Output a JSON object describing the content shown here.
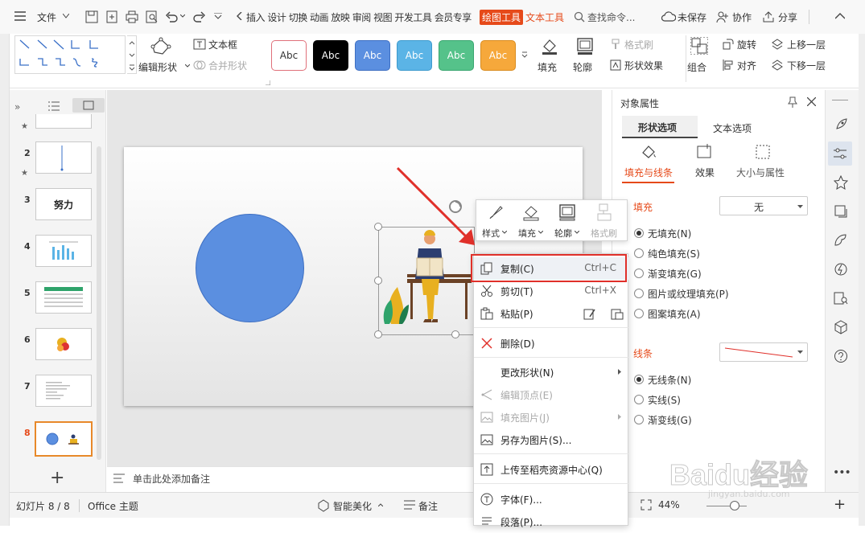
{
  "titlebar": {
    "menu_label": "文件",
    "tabs": [
      "插入",
      "设计",
      "切换",
      "动画",
      "放映",
      "审阅",
      "视图",
      "开发工具",
      "会员专享"
    ],
    "active_tab": "绘图工具",
    "extra_tab": "文本工具",
    "search_placeholder": "查找命令...",
    "unsaved": "未保存",
    "collab": "协作",
    "share": "分享"
  },
  "ribbon": {
    "edit_shape": "编辑形状",
    "textbox": "文本框",
    "merge_shape": "合并形状",
    "style_samples": [
      "Abc",
      "Abc",
      "Abc",
      "Abc",
      "Abc",
      "Abc"
    ],
    "fill": "填充",
    "outline": "轮廓",
    "format_painter": "格式刷",
    "shape_effects": "形状效果",
    "group": "组合",
    "rotate": "旋转",
    "align": "对齐",
    "bring_forward": "上移一层",
    "send_backward": "下移一层"
  },
  "slides": {
    "numbers": [
      "2",
      "3",
      "4",
      "5",
      "6",
      "7",
      "8"
    ],
    "thumb3_text": "努力",
    "active": "8"
  },
  "notes_placeholder": "单击此处添加备注",
  "status": {
    "slide_count": "幻灯片 8 / 8",
    "theme": "Office 主题",
    "beautify": "智能美化",
    "notes": "备注",
    "zoom": "44%"
  },
  "right_panel": {
    "title": "对象属性",
    "tab_shape": "形状选项",
    "tab_text": "文本选项",
    "sub_fill_line": "填充与线条",
    "sub_effects": "效果",
    "sub_size": "大小与属性",
    "fill_heading": "填充",
    "fill_value": "无",
    "fill_options": [
      "无填充(N)",
      "纯色填充(S)",
      "渐变填充(G)",
      "图片或纹理填充(P)",
      "图案填充(A)"
    ],
    "line_heading": "线条",
    "line_options": [
      "无线条(N)",
      "实线(S)",
      "渐变线(G)"
    ]
  },
  "mini_toolbar": {
    "style": "样式",
    "fill": "填充",
    "outline": "轮廓",
    "format_painter": "格式刷"
  },
  "context_menu": {
    "items": [
      {
        "label": "复制(C)",
        "shortcut": "Ctrl+C"
      },
      {
        "label": "剪切(T)",
        "shortcut": "Ctrl+X"
      },
      {
        "label": "粘贴(P)",
        "shortcut": ""
      },
      {
        "label": "删除(D)",
        "shortcut": ""
      },
      {
        "label": "更改形状(N)",
        "shortcut": ""
      },
      {
        "label": "编辑顶点(E)",
        "shortcut": ""
      },
      {
        "label": "填充图片(J)",
        "shortcut": ""
      },
      {
        "label": "另存为图片(S)...",
        "shortcut": ""
      },
      {
        "label": "上传至稻壳资源中心(Q)",
        "shortcut": ""
      },
      {
        "label": "字体(F)...",
        "shortcut": ""
      },
      {
        "label": "段落(P)...",
        "shortcut": ""
      }
    ]
  },
  "watermark": {
    "brand": "Baidu经验",
    "url": "jingyan.baidu.com"
  },
  "colors": {
    "accent": "#e64a1a",
    "circle_fill": "#5b8fe0",
    "highlight_box": "#e0302a",
    "style_colors": [
      "#ffffff",
      "#000000",
      "#5b8fe0",
      "#5bb4e6",
      "#55c28a",
      "#f6a83b"
    ]
  }
}
